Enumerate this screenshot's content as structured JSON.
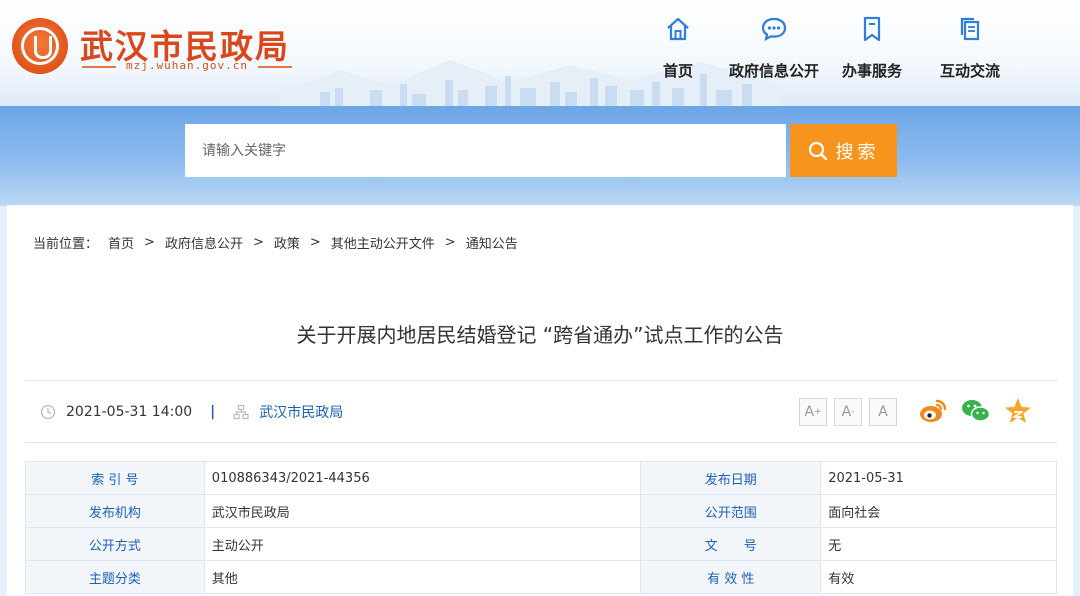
{
  "site": {
    "title": "武汉市民政局",
    "url": "mzj.wuhan.gov.cn"
  },
  "nav": [
    {
      "label": "首页",
      "icon": "home-icon"
    },
    {
      "label": "政府信息公开",
      "icon": "chat-bubble-icon"
    },
    {
      "label": "办事服务",
      "icon": "bookmark-icon"
    },
    {
      "label": "互动交流",
      "icon": "documents-icon"
    }
  ],
  "search": {
    "placeholder": "请输入关键字",
    "button_label": "搜索"
  },
  "breadcrumb": {
    "prefix": "当前位置：",
    "items": [
      "首页",
      "政府信息公开",
      "政策",
      "其他主动公开文件",
      "通知公告"
    ],
    "separator": ">"
  },
  "article": {
    "title": "关于开展内地居民结婚登记 “跨省通办”试点工作的公告",
    "datetime": "2021-05-31 14:00",
    "divider": "|",
    "source": "武汉市民政局"
  },
  "font_sizes": [
    {
      "label": "A",
      "mark": "+"
    },
    {
      "label": "A",
      "mark": "-"
    },
    {
      "label": "A",
      "mark": ""
    }
  ],
  "share": {
    "weibo_icon": "weibo-icon",
    "wechat_icon": "wechat-icon",
    "favorite_icon": "star-icon"
  },
  "info_table": [
    [
      {
        "k": "索 引 号",
        "v": "010886343/2021-44356"
      },
      {
        "k": "发布日期",
        "v": "2021-05-31"
      }
    ],
    [
      {
        "k": "发布机构",
        "v": "武汉市民政局"
      },
      {
        "k": "公开范围",
        "v": "面向社会"
      }
    ],
    [
      {
        "k": "公开方式",
        "v": "主动公开"
      },
      {
        "k": "文　　号",
        "v": "无"
      }
    ],
    [
      {
        "k": "主题分类",
        "v": "其他"
      },
      {
        "k": "有 效 性",
        "v": "有效"
      }
    ]
  ],
  "colors": {
    "brand": "#d9471a",
    "link": "#1c5fb3",
    "search_button": "#f7941d",
    "band": "#6ba6e6"
  }
}
